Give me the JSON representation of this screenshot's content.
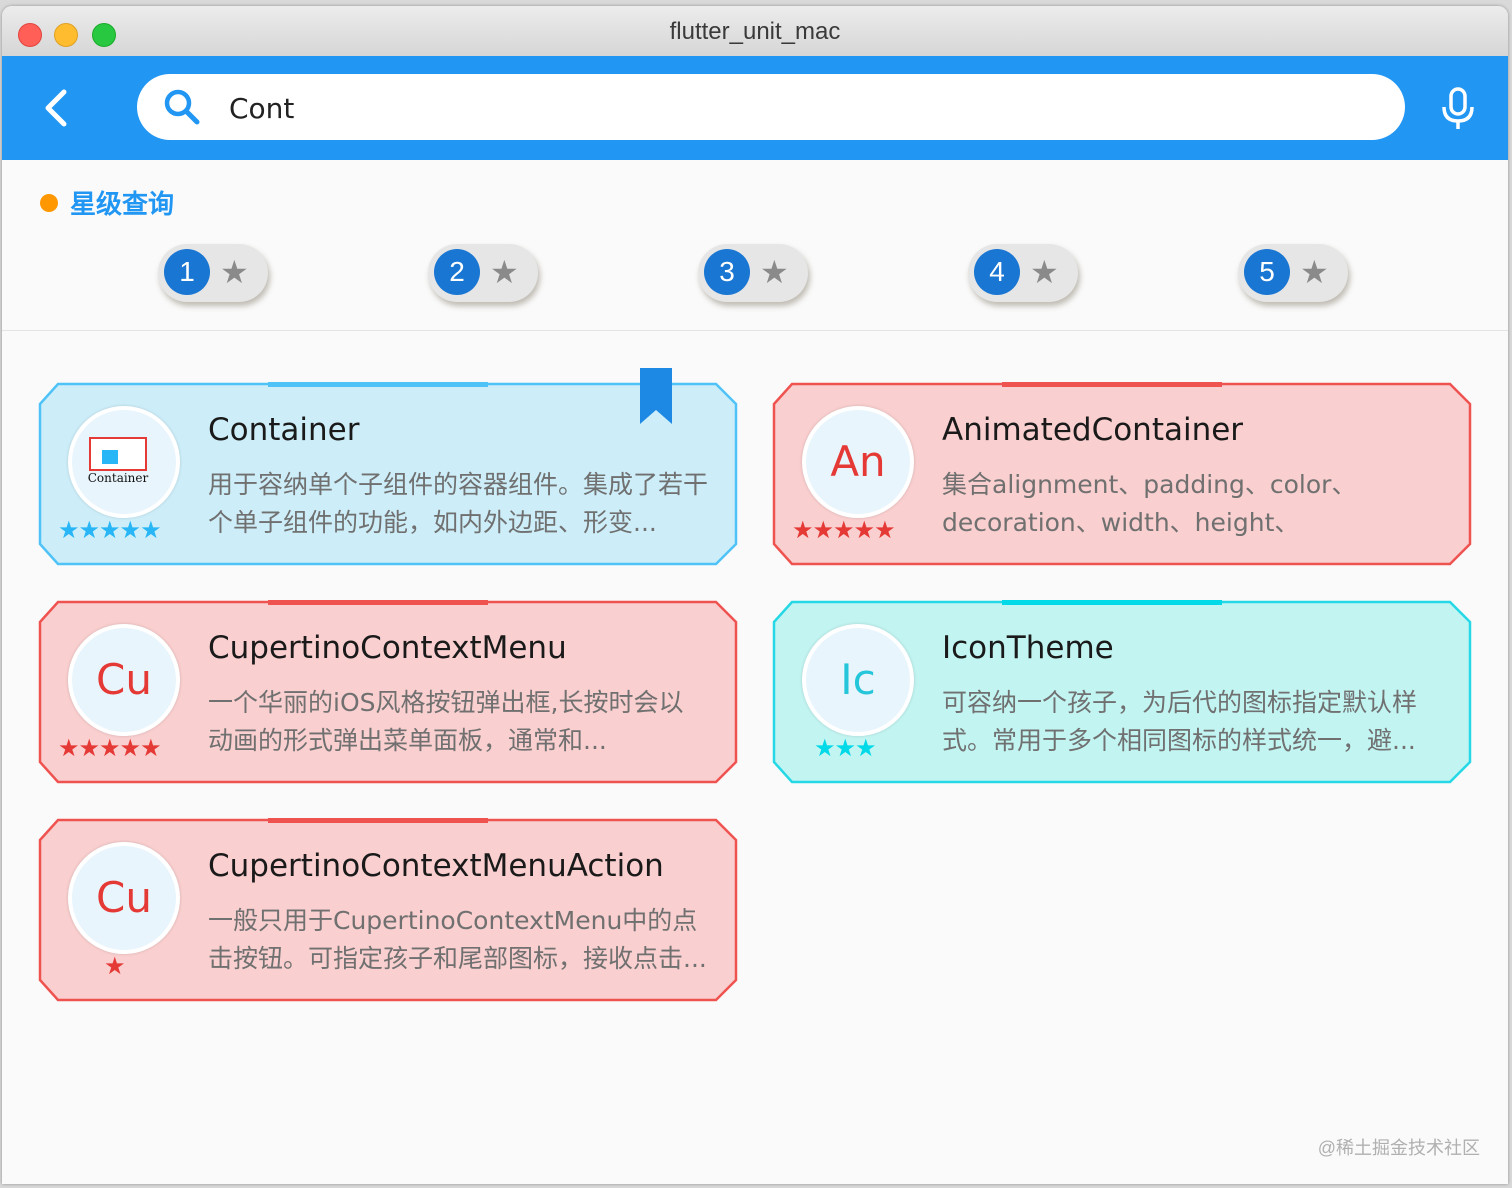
{
  "window": {
    "title": "flutter_unit_mac"
  },
  "search": {
    "value": "Cont"
  },
  "filter": {
    "title": "星级查询",
    "buttons": [
      {
        "num": "1"
      },
      {
        "num": "2"
      },
      {
        "num": "3"
      },
      {
        "num": "4"
      },
      {
        "num": "5"
      }
    ]
  },
  "colors": {
    "appbar": "#2196f3",
    "blue_card": "#cdeef9",
    "red_card": "#f9cfcf",
    "cyan_card": "#c2f4f2"
  },
  "cards": [
    {
      "title": "Container",
      "desc": "用于容纳单个子组件的容器组件。集成了若干个单子组件的功能，如内外边距、形变...",
      "stars": 5,
      "avatar_text": "Container",
      "theme": "blue",
      "bookmarked": true
    },
    {
      "title": "AnimatedContainer",
      "desc": "集合alignment、padding、color、decoration、width、height、constraints、...",
      "stars": 5,
      "avatar_text": "An",
      "theme": "red",
      "bookmarked": false
    },
    {
      "title": "CupertinoContextMenu",
      "desc": "一个华丽的iOS风格按钮弹出框,长按时会以动画的形式弹出菜单面板，通常和...",
      "stars": 5,
      "avatar_text": "Cu",
      "theme": "red",
      "bookmarked": false
    },
    {
      "title": "IconTheme",
      "desc": "可容纳一个孩子，为后代的图标指定默认样式。常用于多个相同图标的样式统一，避...",
      "stars": 3,
      "avatar_text": "Ic",
      "theme": "cyan",
      "bookmarked": false
    },
    {
      "title": "CupertinoContextMenuAction",
      "desc": "一般只用于CupertinoContextMenu中的点击按钮。可指定孩子和尾部图标，接收点击...",
      "stars": 1,
      "avatar_text": "Cu",
      "theme": "red",
      "bookmarked": false
    }
  ],
  "watermark": "@稀土掘金技术社区"
}
